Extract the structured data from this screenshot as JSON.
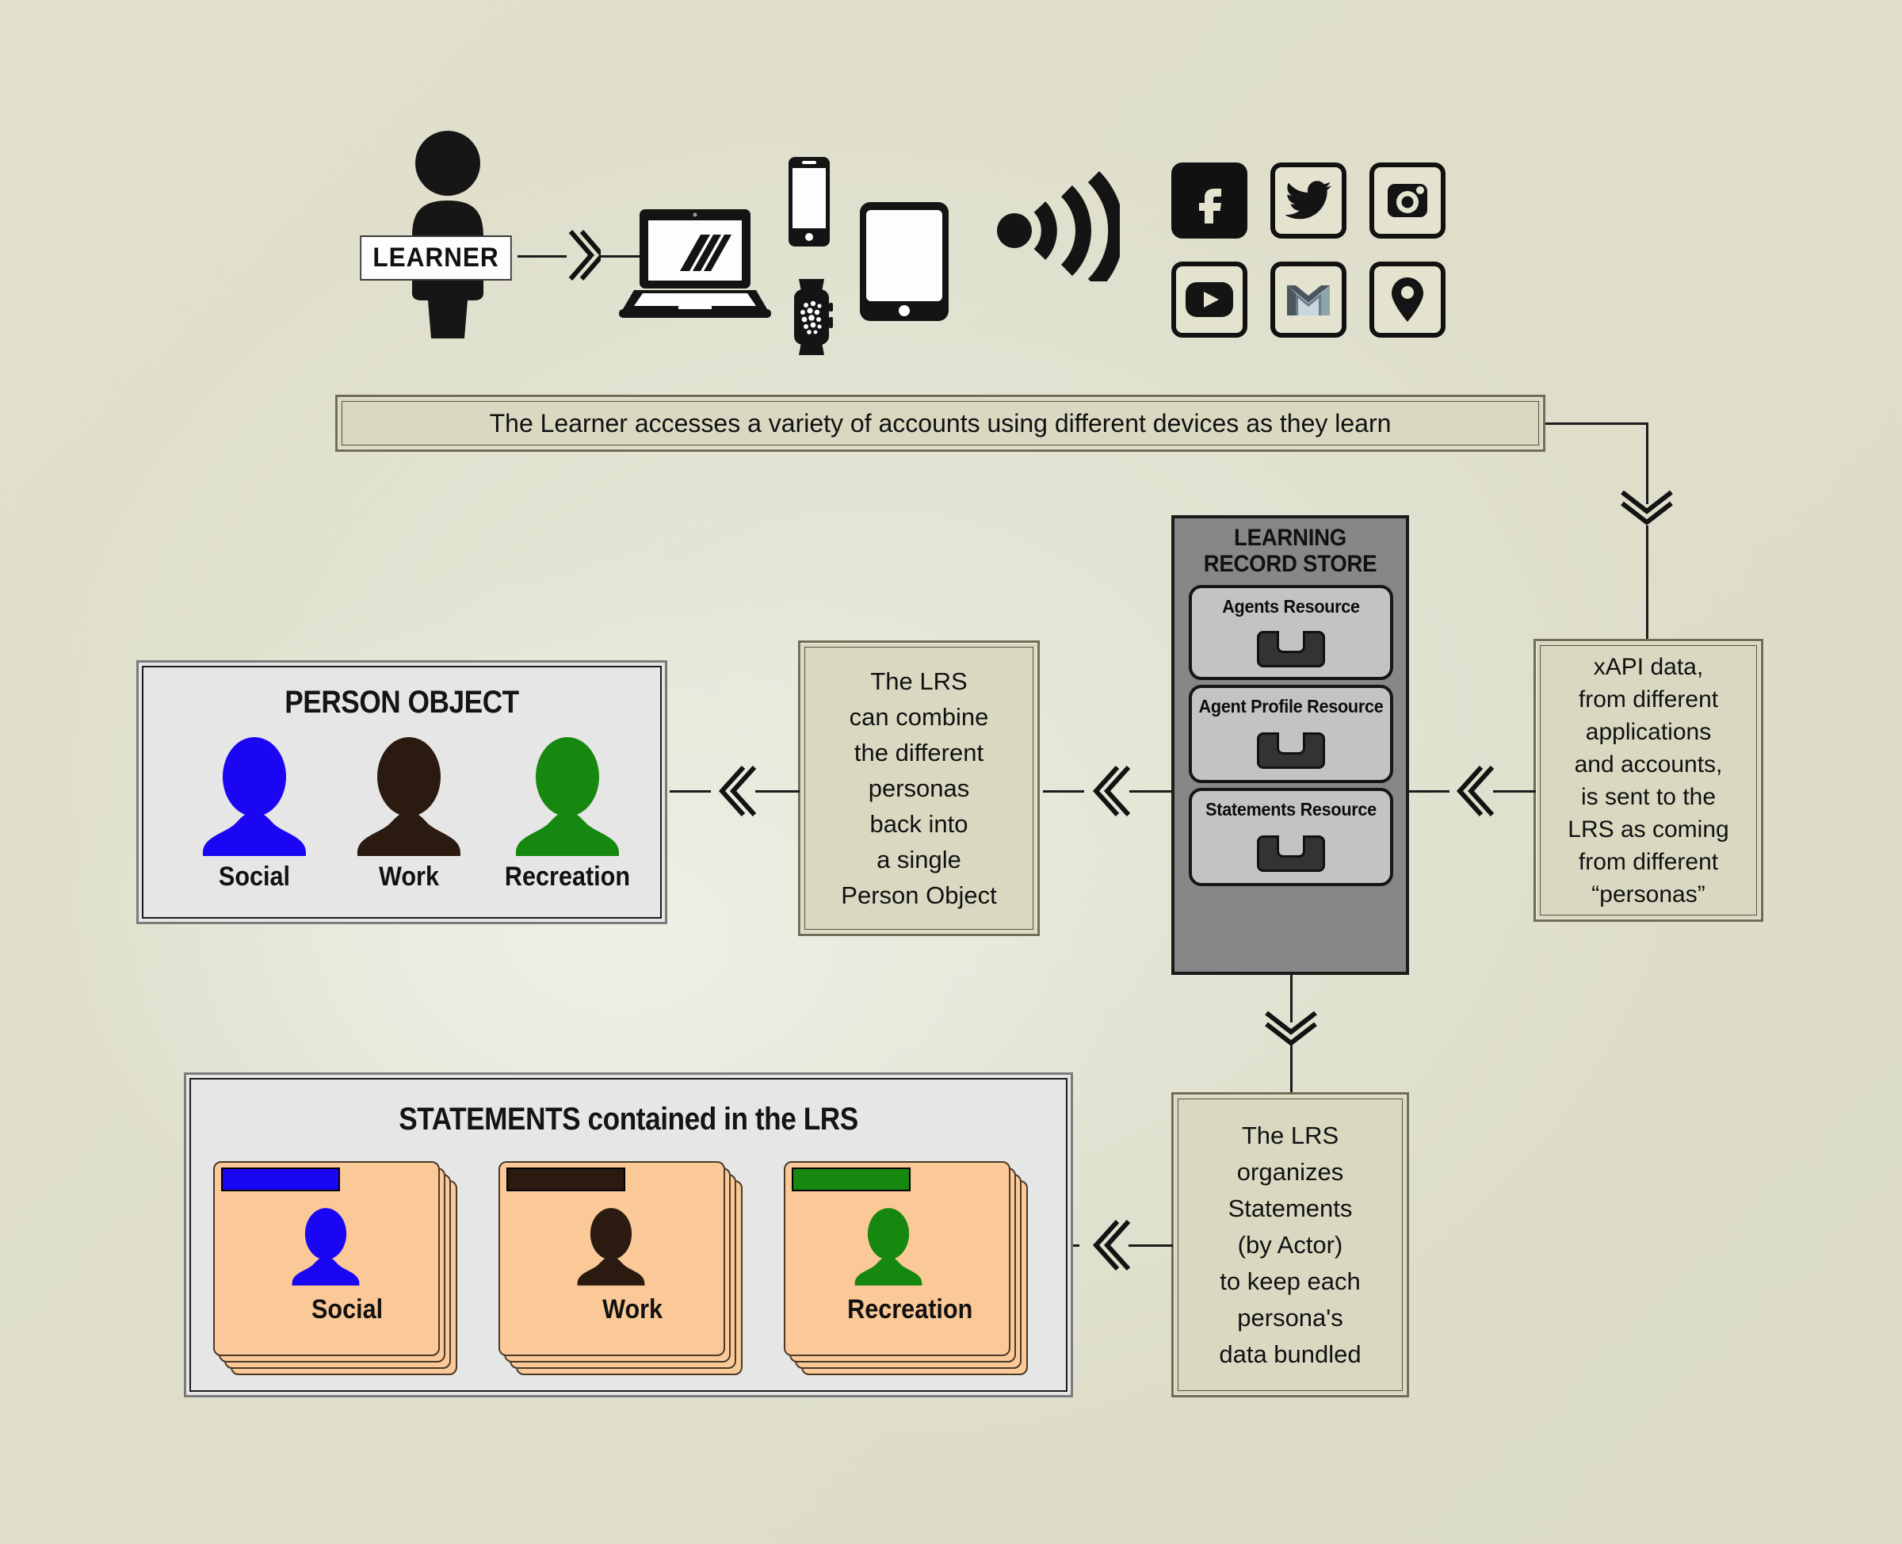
{
  "meta": {
    "background_color": "#dfdfcc",
    "accent_colors": {
      "olive_box_fill": "#d9d9c2",
      "olive_box_border": "#6e6e55",
      "panel_fill": "#e6e6e6",
      "cabinet_gray": "#878787",
      "drawer_gray": "#c3c3c3",
      "folder_orange": "#fbc997",
      "social_blue": "#1a06f3",
      "work_brown": "#2b1a10",
      "recreation_green": "#16870f"
    }
  },
  "learner": {
    "label": "LEARNER",
    "icon": "person-silhouette-icon"
  },
  "devices": [
    {
      "name": "laptop-icon",
      "label": "Laptop"
    },
    {
      "name": "smartphone-icon",
      "label": "Smartphone"
    },
    {
      "name": "smartwatch-icon",
      "label": "Smartwatch"
    },
    {
      "name": "tablet-icon",
      "label": "Tablet"
    },
    {
      "name": "wifi-signal-icon",
      "label": "Wireless signal"
    }
  ],
  "social_accounts": [
    {
      "name": "facebook-icon",
      "label": "Facebook"
    },
    {
      "name": "twitter-icon",
      "label": "Twitter"
    },
    {
      "name": "instagram-icon",
      "label": "Instagram"
    },
    {
      "name": "youtube-icon",
      "label": "YouTube"
    },
    {
      "name": "gmail-icon",
      "label": "Gmail"
    },
    {
      "name": "location-pin-icon",
      "label": "Location"
    }
  ],
  "captions": {
    "learner_caption": "The Learner accesses a variety of accounts using different devices as they learn",
    "xapi_data": "xAPI data,\nfrom different\napplications\nand accounts,\nis sent to the\nLRS as coming\nfrom different\n“personas”",
    "lrs_combine": "The LRS\ncan combine\nthe different\npersonas\nback into\na single\nPerson Object",
    "lrs_organize": "The LRS\norganizes\nStatements\n(by Actor)\nto keep each\npersona's\ndata bundled"
  },
  "lrs": {
    "title_line1": "LEARNING",
    "title_line2": "RECORD STORE",
    "drawers": [
      {
        "label": "Agents Resource"
      },
      {
        "label": "Agent Profile Resource"
      },
      {
        "label": "Statements Resource"
      }
    ]
  },
  "person_object": {
    "title": "PERSON OBJECT",
    "personas": [
      {
        "label": "Social",
        "color": "#1a06f3"
      },
      {
        "label": "Work",
        "color": "#2b1a10"
      },
      {
        "label": "Recreation",
        "color": "#16870f"
      }
    ]
  },
  "statements": {
    "title_strong": "STATEMENTS",
    "title_rest": " contained in the LRS",
    "folders": [
      {
        "label": "Social",
        "color": "#1a06f3"
      },
      {
        "label": "Work",
        "color": "#2b1a10"
      },
      {
        "label": "Recreation",
        "color": "#16870f"
      }
    ]
  },
  "arrows": [
    {
      "name": "arrow-learner-to-devices",
      "direction": "right"
    },
    {
      "name": "arrow-caption-to-xapi",
      "direction": "down"
    },
    {
      "name": "arrow-xapi-to-lrs",
      "direction": "left"
    },
    {
      "name": "arrow-lrs-to-combine",
      "direction": "left"
    },
    {
      "name": "arrow-combine-to-person-object",
      "direction": "left"
    },
    {
      "name": "arrow-lrs-to-organize",
      "direction": "down"
    },
    {
      "name": "arrow-organize-to-statements",
      "direction": "left"
    }
  ]
}
